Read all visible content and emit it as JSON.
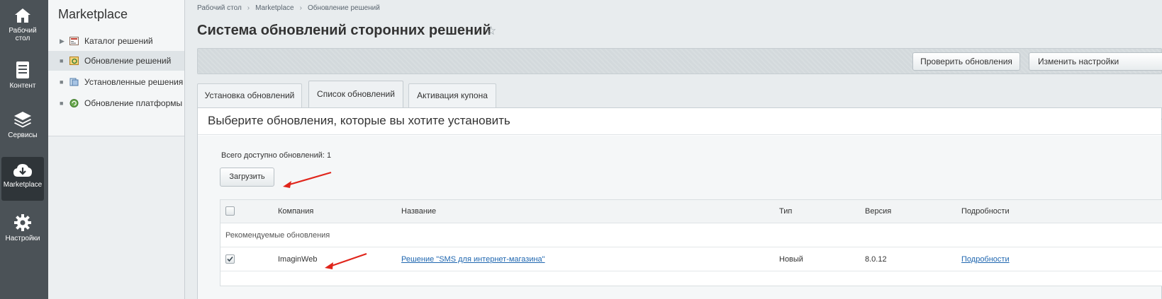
{
  "leftnav": {
    "items": [
      {
        "label": "Рабочий стол",
        "icon": "home-icon"
      },
      {
        "label": "Контент",
        "icon": "document-icon"
      },
      {
        "label": "Сервисы",
        "icon": "layers-icon"
      },
      {
        "label": "Marketplace",
        "icon": "cloud-download-icon",
        "active": true
      },
      {
        "label": "Настройки",
        "icon": "gear-icon"
      }
    ]
  },
  "submenu": {
    "title": "Marketplace",
    "items": [
      {
        "label": "Каталог решений"
      },
      {
        "label": "Обновление решений",
        "active": true
      },
      {
        "label": "Установленные решения"
      },
      {
        "label": "Обновление платформы"
      }
    ]
  },
  "breadcrumb": [
    "Рабочий стол",
    "Marketplace",
    "Обновление решений"
  ],
  "page": {
    "title": "Система обновлений сторонних решений"
  },
  "toolbar": {
    "check_label": "Проверить обновления",
    "settings_label": "Изменить настройки"
  },
  "tabs": [
    {
      "label": "Установка обновлений"
    },
    {
      "label": "Список обновлений",
      "active": true
    },
    {
      "label": "Активация купона"
    }
  ],
  "panel": {
    "title": "Выберите обновления, которые вы хотите установить",
    "total_label": "Всего доступно обновлений:",
    "total_count": "1",
    "load_label": "Загрузить",
    "columns": [
      "Компания",
      "Название",
      "Тип",
      "Версия",
      "Подробности"
    ],
    "group_label": "Рекомендуемые обновления",
    "rows": [
      {
        "company": "ImaginWeb",
        "name": "Решение \"SMS для интернет-магазина\"",
        "type": "Новый",
        "version": "8.0.12",
        "details": "Подробности",
        "checked": true
      }
    ]
  },
  "colors": {
    "nav_bg": "#4b5257",
    "link": "#2067b0",
    "annotation_arrow": "#e0251b"
  }
}
